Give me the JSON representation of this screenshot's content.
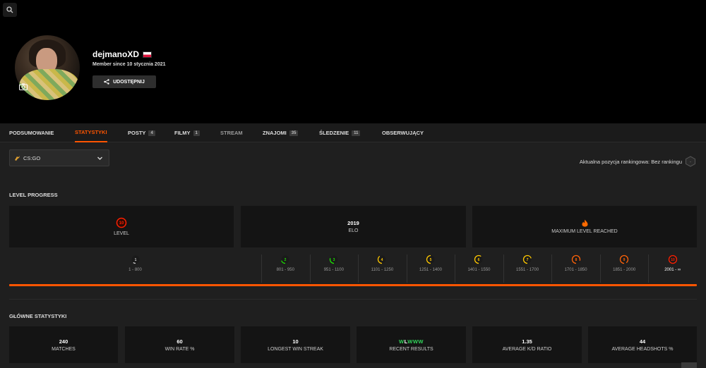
{
  "profile": {
    "username": "dejmanoXD",
    "member_since": "Member since 10 stycznia 2021",
    "share_label": "UDOSTĘPNIJ"
  },
  "tabs": [
    {
      "label": "PODSUMOWANIE",
      "badge": ""
    },
    {
      "label": "STATYSTYKI",
      "badge": ""
    },
    {
      "label": "POSTY",
      "badge": "4"
    },
    {
      "label": "FILMY",
      "badge": "1"
    },
    {
      "label": "STREAM",
      "badge": ""
    },
    {
      "label": "ZNAJOMI",
      "badge": "35"
    },
    {
      "label": "ŚLEDZENIE",
      "badge": "11"
    },
    {
      "label": "OBSERWUJĄCY",
      "badge": ""
    }
  ],
  "game_select": {
    "value": "CS:GO"
  },
  "ranking": {
    "text": "Aktualna pozycja rankingowa: Bez rankingu"
  },
  "level_progress": {
    "title": "LEVEL PROGRESS",
    "cards": [
      {
        "value": "",
        "label": "LEVEL",
        "icon": "level-10"
      },
      {
        "value": "2019",
        "label": "ELO"
      },
      {
        "value": "",
        "label": "MAXIMUM LEVEL REACHED",
        "icon": "fire"
      }
    ],
    "levels": [
      {
        "level": "1",
        "range": "1 - 800",
        "color": "#cfcfcf"
      },
      {
        "level": "2",
        "range": "801 - 950",
        "color": "#1ce400"
      },
      {
        "level": "3",
        "range": "951 - 1100",
        "color": "#1ce400"
      },
      {
        "level": "4",
        "range": "1101 - 1250",
        "color": "#ffc800"
      },
      {
        "level": "5",
        "range": "1251 - 1400",
        "color": "#ffc800"
      },
      {
        "level": "6",
        "range": "1401 - 1550",
        "color": "#ffc800"
      },
      {
        "level": "7",
        "range": "1551 - 1700",
        "color": "#ffc800"
      },
      {
        "level": "8",
        "range": "1701 - 1850",
        "color": "#ff6309"
      },
      {
        "level": "9",
        "range": "1851 - 2000",
        "color": "#ff6309"
      },
      {
        "level": "10",
        "range": "2001 - ∞",
        "color": "#fe1f00"
      }
    ],
    "current_level": 10
  },
  "main_stats": {
    "title": "GŁÓWNE STATYSTYKI",
    "cards": [
      {
        "value": "240",
        "label": "MATCHES"
      },
      {
        "value": "60",
        "label": "WIN RATE %"
      },
      {
        "value": "10",
        "label": "LONGEST WIN STREAK"
      },
      {
        "value": "WLWWW",
        "label": "RECENT RESULTS"
      },
      {
        "value": "1.35",
        "label": "AVERAGE K/D RATIO"
      },
      {
        "value": "44",
        "label": "AVERAGE HEADSHOTS %"
      }
    ]
  },
  "colors": {
    "accent": "#ff5500",
    "win": "#32d35a",
    "header_bg": "#000000",
    "page_bg": "#1f1f1f",
    "card_bg": "#141414"
  }
}
